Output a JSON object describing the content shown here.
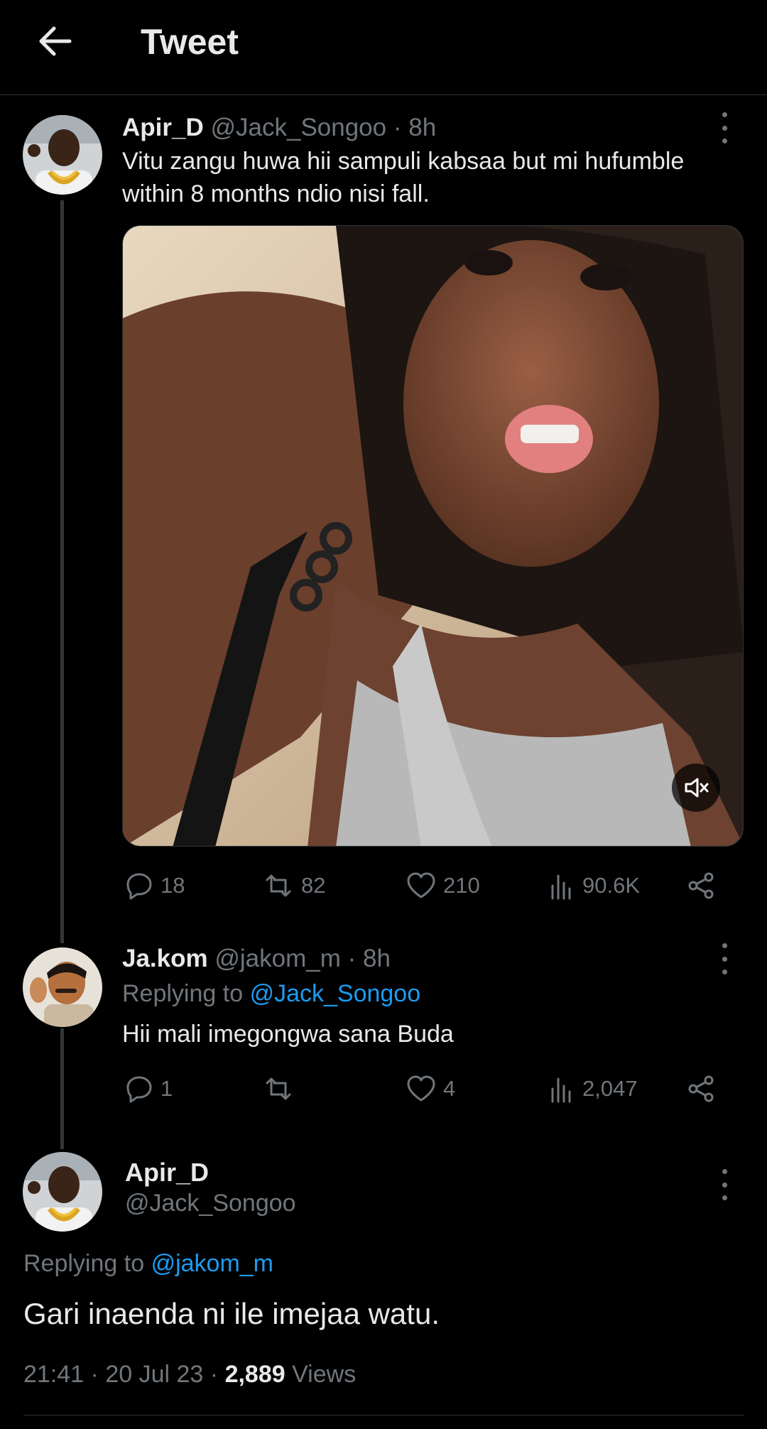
{
  "header": {
    "title": "Tweet"
  },
  "thread": [
    {
      "name": "Apir_D",
      "handle": "@Jack_Songoo",
      "time": "· 8h",
      "text": "Vitu zangu huwa hii sampuli kabsaa but mi hufumble within 8 months ndio nisi fall.",
      "media": {
        "type": "video",
        "muted": true
      },
      "stats": {
        "replies": "18",
        "retweets": "82",
        "likes": "210",
        "views": "90.6K"
      }
    },
    {
      "name": "Ja.kom",
      "handle": "@jakom_m",
      "time": "· 8h",
      "replying_prefix": "Replying to",
      "replying_to": "@Jack_Songoo",
      "text": "Hii mali imegongwa sana Buda",
      "stats": {
        "replies": "1",
        "retweets": "",
        "likes": "4",
        "views": "2,047"
      }
    }
  ],
  "main_tweet": {
    "name": "Apir_D",
    "handle": "@Jack_Songoo",
    "replying_prefix": "Replying to",
    "replying_to": "@jakom_m",
    "text": "Gari inaenda ni ile imejaa watu.",
    "time": "21:41",
    "date": "20 Jul 23",
    "views_count": "2,889",
    "views_label": "Views"
  },
  "colors": {
    "background": "#000000",
    "text": "#e7e9ea",
    "muted": "#71767b",
    "link": "#1d9bf0",
    "divider": "#2f3336"
  }
}
